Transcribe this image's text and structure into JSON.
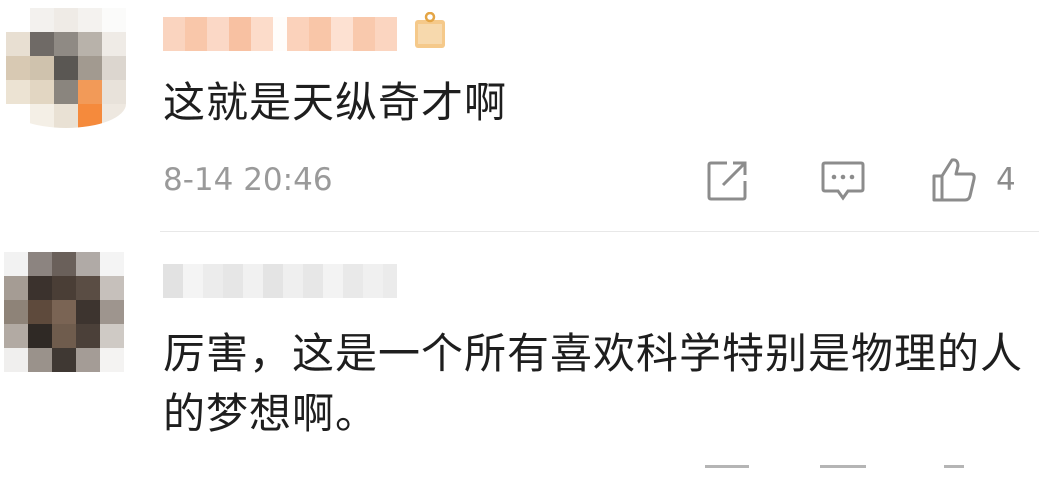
{
  "comments": [
    {
      "text": "这就是天纵奇才啊",
      "timestamp": "8-14 20:46",
      "like_count": "4",
      "actions": {
        "repost_icon": "repost-edit-icon",
        "reply_icon": "comment-bubble-icon",
        "like_icon": "thumbs-up-icon"
      },
      "badge_icon": "vip-crown-icon"
    },
    {
      "text": "厉害，这是一个所有喜欢科学特别是物理的人的梦想啊。"
    }
  ],
  "colors": {
    "text": "#1e1e1e",
    "meta": "#9a9a9a",
    "icon": "#8c8c8c",
    "divider": "#e8e8e8",
    "username_pixels": "#f9c9ad",
    "badge": "#f0b65a"
  }
}
